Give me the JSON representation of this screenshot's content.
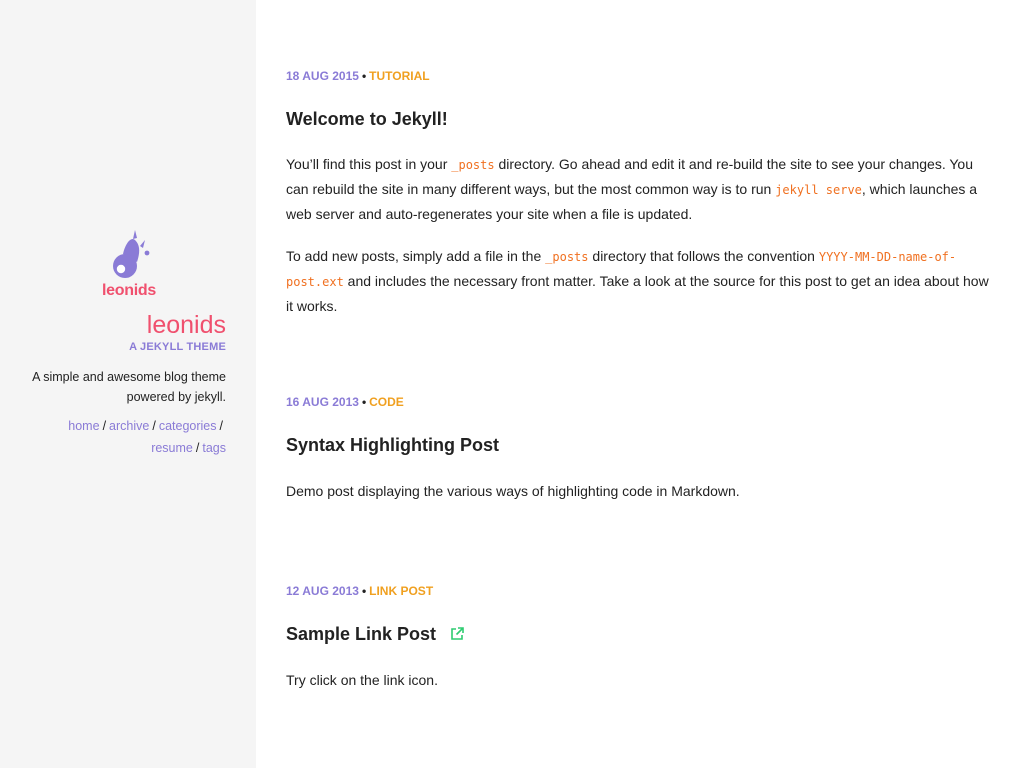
{
  "sidebar": {
    "logo_text": "leonids",
    "title": "leonids",
    "tagline": "A JEKYLL THEME",
    "description_line1": "A simple and awesome blog theme",
    "description_line2": "powered by jekyll.",
    "nav": {
      "home": "home",
      "archive": "archive",
      "categories": "categories",
      "resume": "resume",
      "tags": "tags",
      "separator": "/"
    }
  },
  "posts": [
    {
      "date": "18 AUG 2015",
      "category": "TUTORIAL",
      "title": "Welcome to Jekyll!",
      "p1": {
        "a": "You’ll find this post in your ",
        "code1": "_posts",
        "b": " directory. Go ahead and edit it and re-build the site to see your changes. You can rebuild the site in many different ways, but the most common way is to run ",
        "code2": "jekyll serve",
        "c": ", which launches a web server and auto-regenerates your site when a file is updated."
      },
      "p2": {
        "a": "To add new posts, simply add a file in the ",
        "code1": "_posts",
        "b": " directory that follows the convention ",
        "code2": "YYYY-MM-DD-name-of-post.ext",
        "c": " and includes the necessary front matter. Take a look at the source for this post to get an idea about how it works."
      }
    },
    {
      "date": "16 AUG 2013",
      "category": "CODE",
      "title": "Syntax Highlighting Post",
      "body": "Demo post displaying the various ways of highlighting code in Markdown."
    },
    {
      "date": "12 AUG 2013",
      "category": "LINK POST",
      "title": "Sample Link Post",
      "body": "Try click on the link icon."
    }
  ],
  "meta_separator": "•",
  "colors": {
    "accent_pink": "#f0506e",
    "accent_purple": "#8a7bd6",
    "category_orange": "#f0a020",
    "code_orange": "#f07020",
    "link_icon_green": "#2ecc71",
    "sidebar_bg": "#f5f5f5"
  },
  "icons": {
    "logo": "meteor-logo-icon",
    "external_link": "external-link-icon"
  }
}
